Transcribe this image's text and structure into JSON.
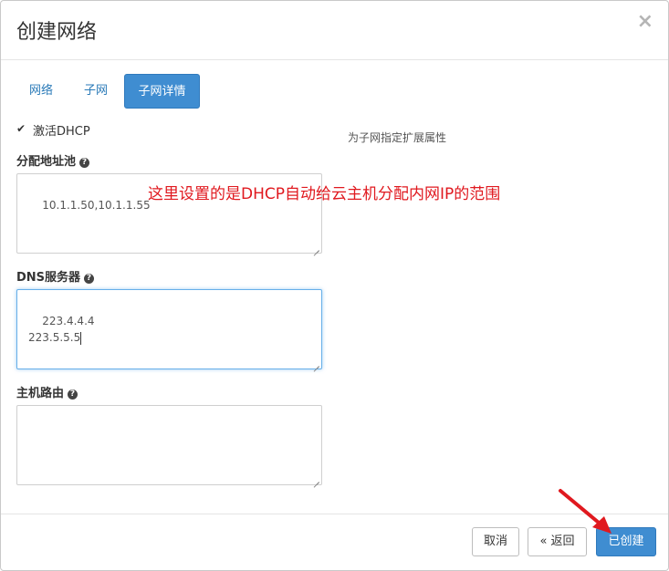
{
  "dialog": {
    "title": "创建网络",
    "close_symbol": "×"
  },
  "tabs": [
    {
      "label": "网络",
      "active": false
    },
    {
      "label": "子网",
      "active": false
    },
    {
      "label": "子网详情",
      "active": true
    }
  ],
  "form": {
    "enable_dhcp": {
      "label": "激活DHCP",
      "checked": true
    },
    "hint": "为子网指定扩展属性",
    "allocation_pools": {
      "label": "分配地址池",
      "value": "10.1.1.50,10.1.1.55"
    },
    "dns_servers": {
      "label": "DNS服务器",
      "value": "223.4.4.4\n223.5.5.5"
    },
    "host_routes": {
      "label": "主机路由",
      "value": ""
    },
    "help_symbol": "?"
  },
  "annotation": {
    "text": "这里设置的是DHCP自动给云主机分配内网IP的范围",
    "color": "#e0191f"
  },
  "footer": {
    "cancel_label": "取消",
    "back_label": "« 返回",
    "create_label": "已创建"
  },
  "colors": {
    "primary": "#3f8dd1",
    "link": "#2a7ab8",
    "arrow": "#e0191f"
  }
}
